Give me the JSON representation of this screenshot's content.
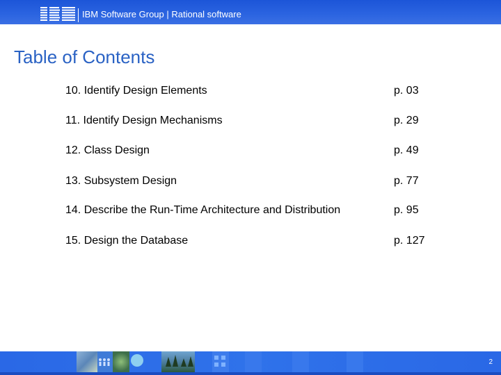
{
  "header": {
    "brand_text": "IBM Software Group | Rational software",
    "logo_text": "IBM"
  },
  "title": "Table of Contents",
  "toc": [
    {
      "label": "10. Identify Design Elements",
      "page": "p. 03"
    },
    {
      "label": "11. Identify Design Mechanisms",
      "page": "p. 29"
    },
    {
      "label": "12. Class Design",
      "page": "p. 49"
    },
    {
      "label": "13. Subsystem Design",
      "page": "p. 77"
    },
    {
      "label": "14. Describe the Run-Time Architecture and Distribution",
      "page": "p. 95"
    },
    {
      "label": "15. Design the Database",
      "page": "p. 127"
    }
  ],
  "footer": {
    "page_number": "2"
  },
  "colors": {
    "header_blue": "#1c55d8",
    "title_blue": "#2a62c4",
    "footer_blue": "#2a68e6"
  }
}
